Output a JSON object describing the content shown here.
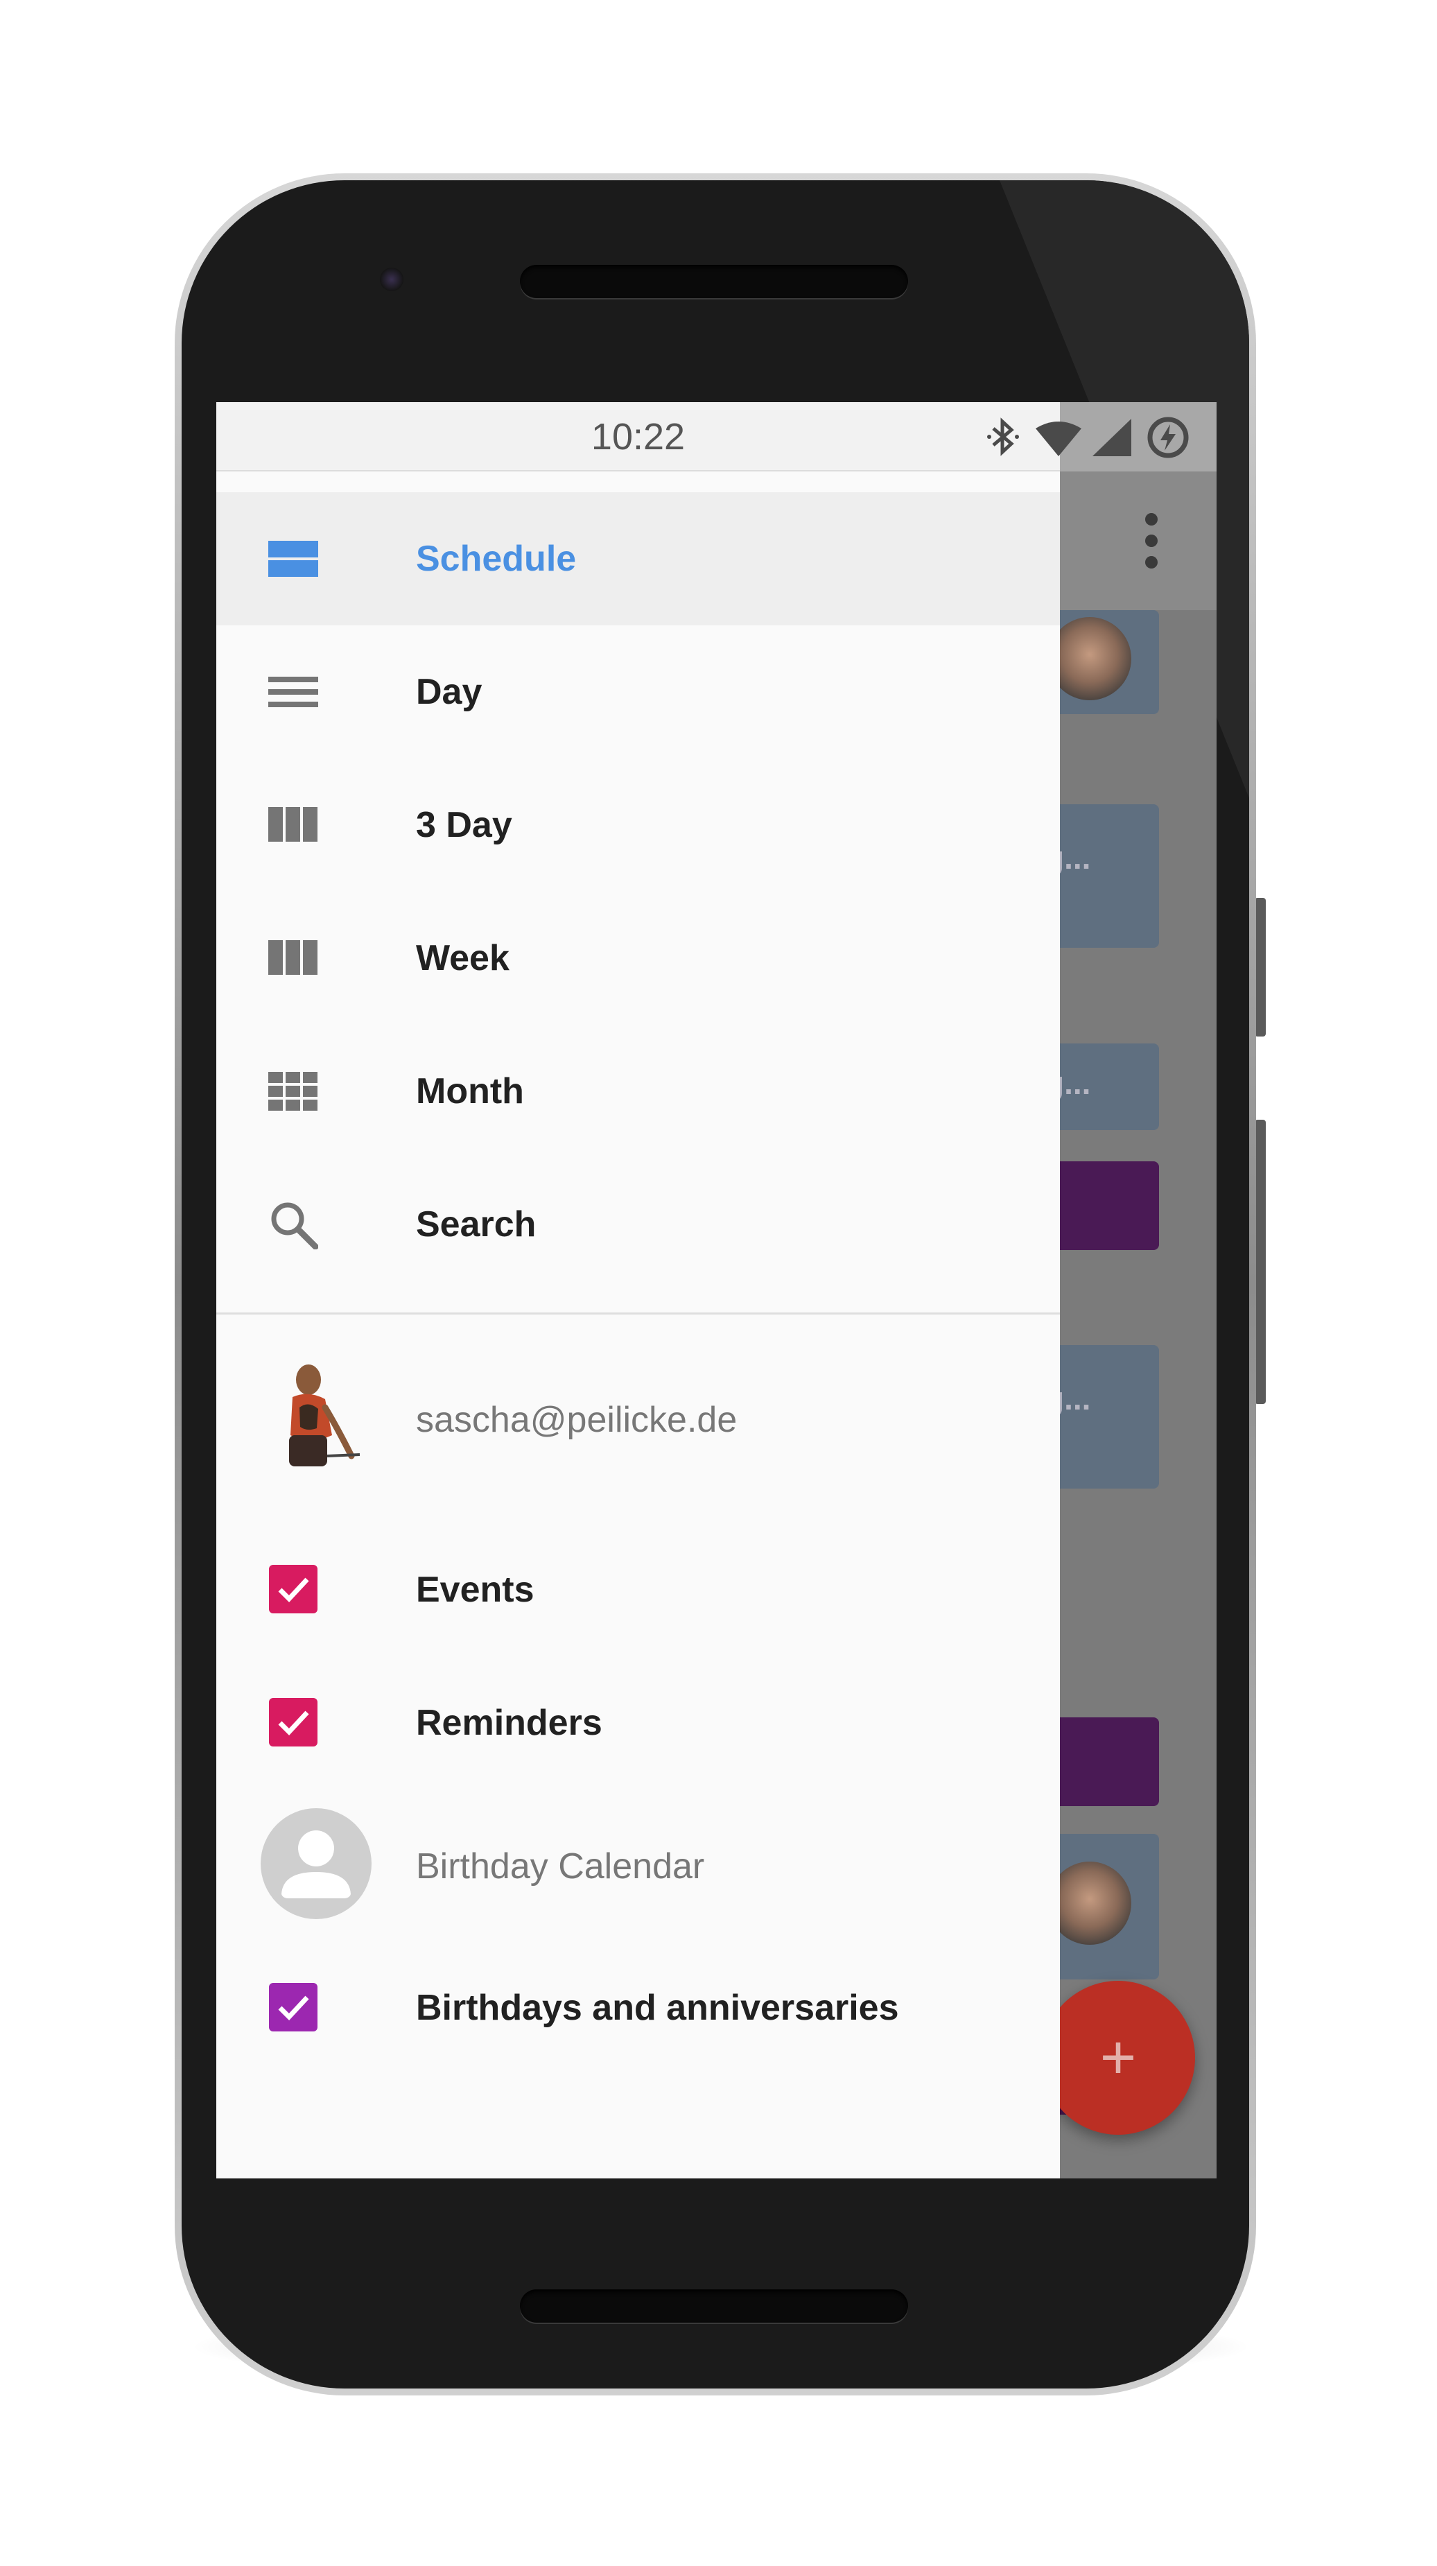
{
  "status_bar": {
    "time": "10:22"
  },
  "drawer": {
    "nav_items": [
      {
        "label": "Schedule",
        "icon": "schedule-view-icon",
        "active": true
      },
      {
        "label": "Day",
        "icon": "day-view-icon"
      },
      {
        "label": "3 Day",
        "icon": "three-day-view-icon"
      },
      {
        "label": "Week",
        "icon": "week-view-icon"
      },
      {
        "label": "Month",
        "icon": "month-view-icon"
      },
      {
        "label": "Search",
        "icon": "search-icon"
      }
    ],
    "accounts": [
      {
        "name": "sascha@peilicke.de",
        "avatar": "user-photo-avatar",
        "calendars": [
          {
            "label": "Events",
            "checked": true,
            "color": "#d81b60"
          },
          {
            "label": "Reminders",
            "checked": true,
            "color": "#d81b60"
          }
        ]
      },
      {
        "name": "Birthday Calendar",
        "avatar": "generic-person-avatar",
        "calendars": [
          {
            "label": "Birthdays and anniversaries",
            "checked": true,
            "color": "#9c27b0"
          }
        ]
      }
    ]
  },
  "background": {
    "cards": [
      {
        "text": "g..."
      },
      {
        "text": "g..."
      },
      {
        "text": "g..."
      }
    ],
    "fab": {
      "label": "+"
    }
  },
  "colors": {
    "accent": "#4a90e2",
    "event_check": "#d81b60",
    "birthday_check": "#9c27b0",
    "fab": "#bb2f24"
  }
}
